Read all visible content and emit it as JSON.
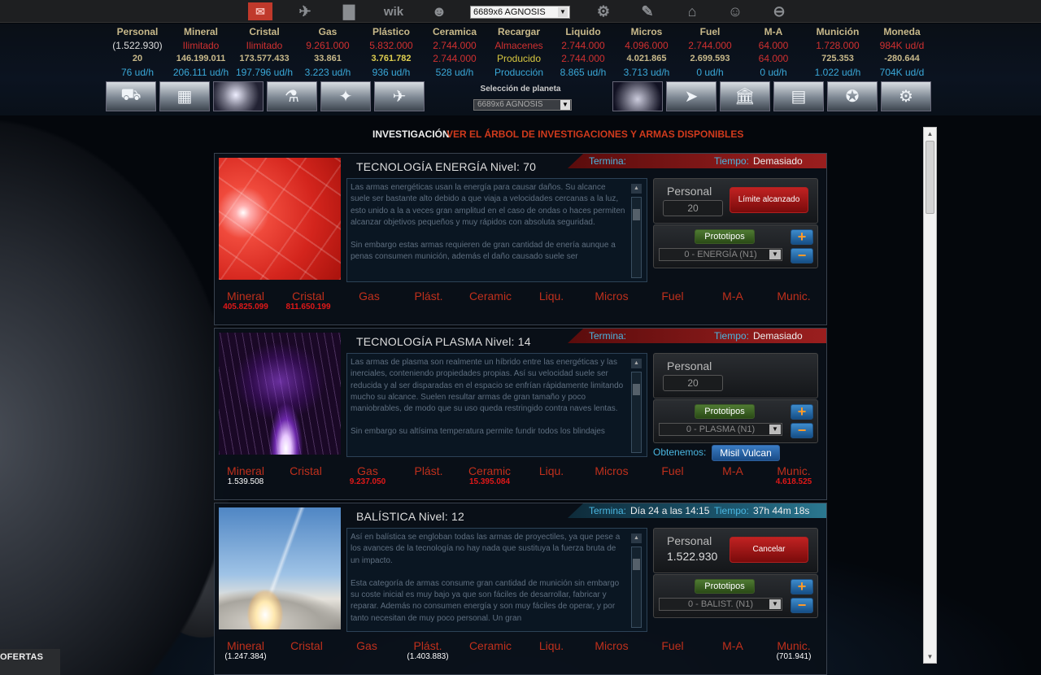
{
  "topbar": {
    "icons": [
      "mail-icon",
      "rocket-icon",
      "stats-icon",
      "wiki-icon",
      "alien-icon",
      "gear-icon",
      "user-edit-icon",
      "shop-icon",
      "officer-icon",
      "minus-circle-icon"
    ],
    "wiki_label": "wik",
    "planet_select": "6689x6 AGNOSIS"
  },
  "resources": [
    {
      "name": "Personal",
      "v1": "(1.522.930)",
      "v2": "20",
      "v3": "76 ud/h"
    },
    {
      "name": "Mineral",
      "v1": "Ilimitado",
      "v2": "146.199.011",
      "v3": "206.111 ud/h"
    },
    {
      "name": "Cristal",
      "v1": "Ilimitado",
      "v2": "173.577.433",
      "v3": "197.796 ud/h"
    },
    {
      "name": "Gas",
      "v1": "9.261.000",
      "v2": "33.861",
      "v3": "3.223 ud/h"
    },
    {
      "name": "Plástico",
      "v1": "5.832.000",
      "v2": "3.761.782",
      "v3": "936 ud/h"
    },
    {
      "name": "Ceramica",
      "v1": "2.744.000",
      "v2": "2.744.000",
      "v3": "528 ud/h"
    },
    {
      "name": "Recargar",
      "v1": "Almacenes",
      "v2": "Producido",
      "v3": "Producción"
    },
    {
      "name": "Liquido",
      "v1": "2.744.000",
      "v2": "2.744.000",
      "v3": "8.865 ud/h"
    },
    {
      "name": "Micros",
      "v1": "4.096.000",
      "v2": "4.021.865",
      "v3": "3.713 ud/h"
    },
    {
      "name": "Fuel",
      "v1": "2.744.000",
      "v2": "2.699.593",
      "v3": "0 ud/h"
    },
    {
      "name": "M-A",
      "v1": "64.000",
      "v2": "64.000",
      "v3": "0 ud/h"
    },
    {
      "name": "Munición",
      "v1": "1.728.000",
      "v2": "725.353",
      "v3": "1.022 ud/h"
    },
    {
      "name": "Moneda",
      "v1": "984K ud/d",
      "v2": "-280.644",
      "v3": "704K ud/d"
    }
  ],
  "nav_left": [
    "mining-truck-icon",
    "factory-icon",
    "planet-icon",
    "laboratory-icon",
    "fleet-icon",
    "shipyard-icon"
  ],
  "nav_right": [
    "radar-icon",
    "starfighter-icon",
    "bank-icon",
    "city-icon",
    "alliance-icon",
    "settings-icon"
  ],
  "planet_selection": {
    "label": "Selección de planeta",
    "value": "6689x6 AGNOSIS"
  },
  "tabs": {
    "investigation": "INVESTIGACIÓN",
    "tree": "VER EL ÁRBOL DE INVESTIGACIONES Y ARMAS DISPONIBLES"
  },
  "labels": {
    "termina": "Termina:",
    "tiempo": "Tiempo:",
    "personal": "Personal",
    "prototipos": "Prototipos",
    "obtenemos": "Obtenemos:"
  },
  "cost_names": [
    "Mineral",
    "Cristal",
    "Gas",
    "Plást.",
    "Ceramic",
    "Liqu.",
    "Micros",
    "Fuel",
    "M-A",
    "Munic."
  ],
  "research": [
    {
      "title": "TECNOLOGÍA ENERGÍA Nivel: 70",
      "termina": "",
      "tiempo": "Demasiado",
      "desc": [
        "Las armas energéticas usan la energía para causar daños. Su alcance suele ser bastante alto debido a que viaja a velocidades cercanas a la luz, esto unido a la a veces gran amplitud en el caso de ondas o haces permiten alcanzar objetivos pequeños y muy rápidos con absoluta seguridad.",
        "Sin embargo estas armas requieren de gran cantidad de enería aunque a penas consumen munición, además el daño causado suele ser"
      ],
      "personal_value": "20",
      "action": "Límite alcanzado",
      "prototype": "0 - ENERGÍA (N1)",
      "obtain": "",
      "costs": [
        "405.825.099",
        "811.650.199",
        "",
        "",
        "",
        "",
        "",
        "",
        "",
        ""
      ]
    },
    {
      "title": "TECNOLOGÍA PLASMA Nivel: 14",
      "termina": "",
      "tiempo": "Demasiado",
      "desc": [
        "Las armas de plasma son realmente un híbrido entre las energéticas y las inerciales, conteniendo propiedades propias. Así su velocidad suele ser reducida y al ser disparadas en el espacio se enfrían rápidamente limitando mucho su alcance. Suelen resultar armas de gran tamaño y poco maniobrables, de modo que su uso queda restringido contra naves lentas.",
        "Sin embargo su altísima temperatura permite fundir todos los blindajes"
      ],
      "personal_value": "20",
      "action": "",
      "prototype": "0 - PLASMA (N1)",
      "obtain": "Misil Vulcan",
      "costs": [
        "1.539.508",
        "",
        "9.237.050",
        "",
        "15.395.084",
        "",
        "",
        "",
        "",
        "4.618.525"
      ]
    },
    {
      "title": "BALÍSTICA Nivel: 12",
      "termina": "Día 24 a las 14:15",
      "tiempo": "37h 44m 18s",
      "desc": [
        "Así en balística se engloban todas las armas de proyectiles, ya que pese a los avances de la tecnología no hay nada que sustituya la fuerza bruta de un impacto.",
        "Esta categoría de armas consume gran cantidad de munición sin embargo su coste inicial es muy bajo ya que son fáciles de desarrollar, fabricar y reparar. Además no consumen energía y son muy fáciles de operar, y por tanto necesitan de muy poco personal. Un gran"
      ],
      "personal_value": "1.522.930",
      "action": "Cancelar",
      "prototype": "0 - BALIST. (N1)",
      "obtain": "",
      "costs": [
        "(1.247.384)",
        "",
        "",
        "(1.403.883)",
        "",
        "",
        "",
        "",
        "",
        "(701.941)"
      ]
    }
  ],
  "offers": "OFERTAS"
}
